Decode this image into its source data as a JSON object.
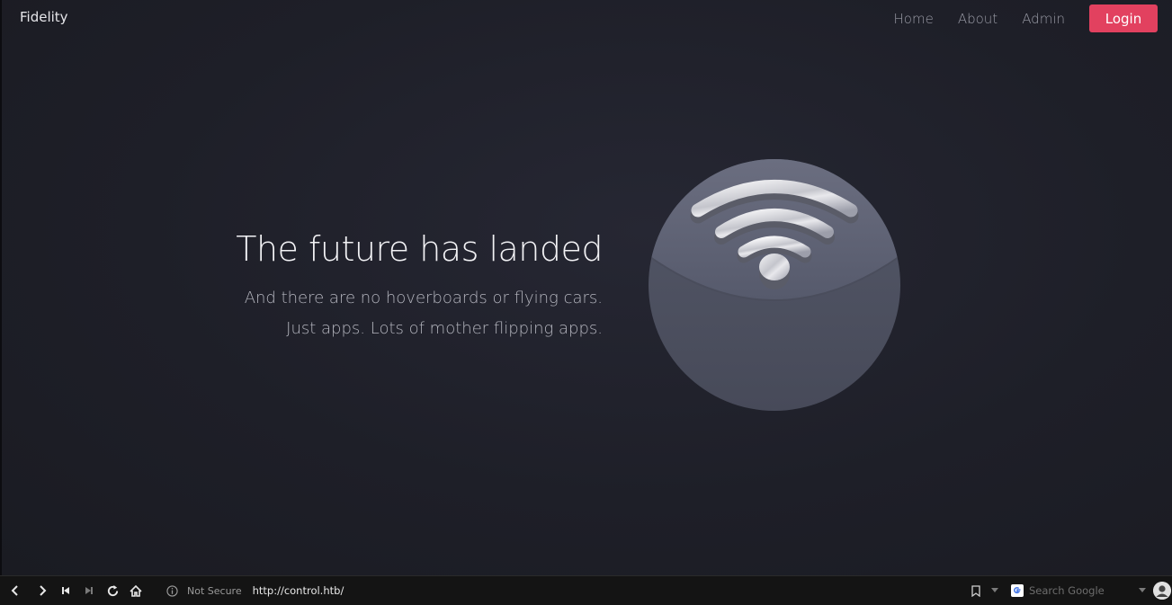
{
  "brand": "Fidelity",
  "nav": {
    "home": "Home",
    "about": "About",
    "admin": "Admin",
    "login": "Login"
  },
  "hero": {
    "title": "The future has landed",
    "line1": "And there are no hoverboards or flying cars.",
    "line2": "Just apps. Lots of mother flipping apps."
  },
  "browser": {
    "security": "Not Secure",
    "url": "http://control.htb/",
    "search_placeholder": "Search Google"
  },
  "icons": {
    "hero": "wifi-orb-icon",
    "back": "back-arrow-icon",
    "forward": "forward-arrow-icon",
    "first": "skip-first-icon",
    "last": "skip-last-icon",
    "reload": "reload-icon",
    "home": "home-icon",
    "info": "info-icon",
    "bookmark": "bookmark-icon",
    "google": "google-icon",
    "avatar": "profile-icon"
  },
  "colors": {
    "accent": "#e2415f",
    "background": "#1f1f28"
  }
}
